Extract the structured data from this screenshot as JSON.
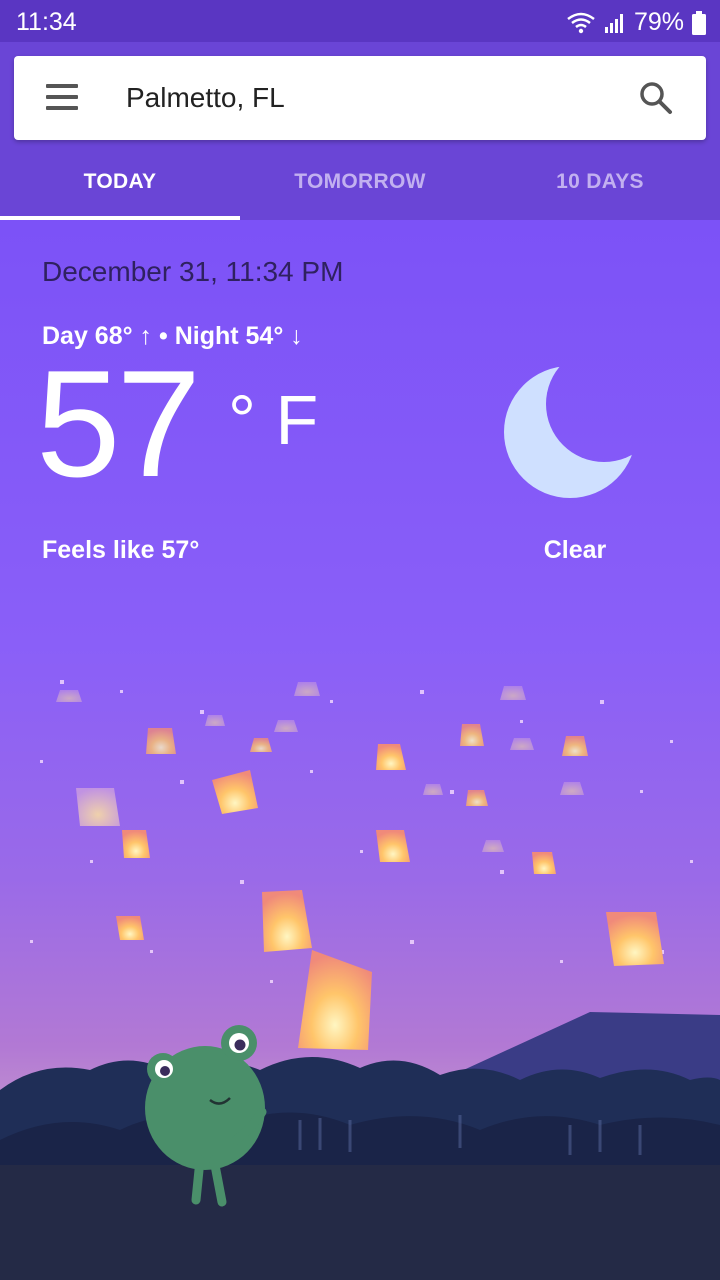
{
  "status_bar": {
    "time": "11:34",
    "battery": "79%",
    "icons": [
      "wifi-icon",
      "signal-icon",
      "battery-icon"
    ]
  },
  "search": {
    "location": "Palmetto, FL",
    "icons": [
      "menu-icon",
      "search-icon"
    ]
  },
  "tabs": [
    {
      "label": "TODAY",
      "active": true
    },
    {
      "label": "TOMORROW",
      "active": false
    },
    {
      "label": "10 DAYS",
      "active": false
    }
  ],
  "weather": {
    "date": "December 31, 11:34 PM",
    "day_night": "Day 68° ↑ • Night 54° ↓",
    "temperature": "57",
    "unit": "° F",
    "feels_like": "Feels like 57°",
    "condition": "Clear",
    "condition_icon": "moon-icon"
  },
  "colors": {
    "header": "#6a45d6",
    "status_bar": "#5a36c2",
    "sky": "#7c52f7"
  }
}
